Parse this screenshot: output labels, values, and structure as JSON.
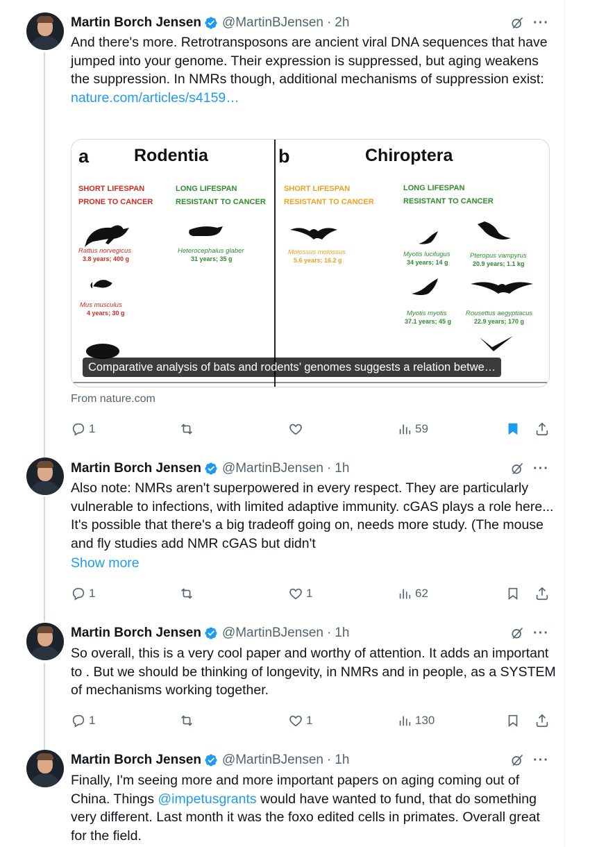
{
  "author": {
    "name": "Martin Borch Jensen",
    "handle": "@MartinBJensen"
  },
  "colors": {
    "link": "#1d9bf0",
    "bookmark_active": "#1d9bf0",
    "muted": "#536471"
  },
  "tweets": [
    {
      "time": "2h",
      "text": "And there's more. Retrotransposons are ancient viral DNA sequences that have jumped into your genome. Their expression is suppressed, but aging weakens the suppression. In NMRs though, additional mechanisms of suppression exist:",
      "link": "nature.com/articles/s4159…",
      "card": {
        "caption": "Comparative analysis of bats and rodents’ genomes suggests a relation betwe…",
        "from": "From nature.com",
        "figure": {
          "panel_a": {
            "letter": "a",
            "title": "Rodentia",
            "short_h1": "SHORT LIFESPAN",
            "short_h2": "PRONE TO CANCER",
            "long_h1": "LONG LIFESPAN",
            "long_h2": "RESISTANT TO CANCER",
            "sp1_name": "Rattus norvegicus",
            "sp1_data": "3.8 years; 400 g",
            "sp2_name": "Heterocephalus glaber",
            "sp2_data": "31 years; 35 g",
            "sp3_name": "Mus musculus",
            "sp3_data": "4 years; 30 g"
          },
          "panel_b": {
            "letter": "b",
            "title": "Chiroptera",
            "short_h1": "SHORT LIFESPAN",
            "short_h2": "RESISTANT TO CANCER",
            "long_h1": "LONG LIFESPAN",
            "long_h2": "RESISTANT TO CANCER",
            "sp1_name": "Molossus molossus",
            "sp1_data": "5.6 years; 16.2 g",
            "sp2_name": "Myotis lucifugus",
            "sp2_data": "34 years; 14 g",
            "sp3_name": "Pteropus vampyrus",
            "sp3_data": "20.9 years; 1.1 kg",
            "sp4_name": "Myotis myotis",
            "sp4_data": "37.1 years; 45 g",
            "sp5_name": "Rousettus aegyptiacus",
            "sp5_data": "22.9 years; 170 g"
          }
        }
      },
      "replies": "1",
      "reposts": "",
      "likes": "",
      "views": "59",
      "bookmarked": true
    },
    {
      "time": "1h",
      "text": "Also note: NMRs aren't superpowered in every respect. They are particularly vulnerable to infections, with limited adaptive immunity. cGAS plays a role here... It's possible that there's a big tradeoff going on, needs more study. (The mouse and fly studies add NMR cGAS but didn't",
      "show_more": "Show more",
      "replies": "1",
      "reposts": "",
      "likes": "1",
      "views": "62",
      "bookmarked": false
    },
    {
      "time": "1h",
      "text": "So overall, this is a very cool paper and worthy of attention. It adds an important to . But we should be thinking of longevity, in NMRs and in people, as a SYSTEM of mechanisms working together.",
      "replies": "1",
      "reposts": "",
      "likes": "1",
      "views": "130",
      "bookmarked": false
    },
    {
      "time": "1h",
      "text_before": "Finally, I'm seeing more and more important papers on aging coming out of China. Things ",
      "mention": "@impetusgrants",
      "text_after": " would have wanted to fund, that do something very different. Last month it was the foxo edited cells in primates. Overall great for the field."
    }
  ]
}
